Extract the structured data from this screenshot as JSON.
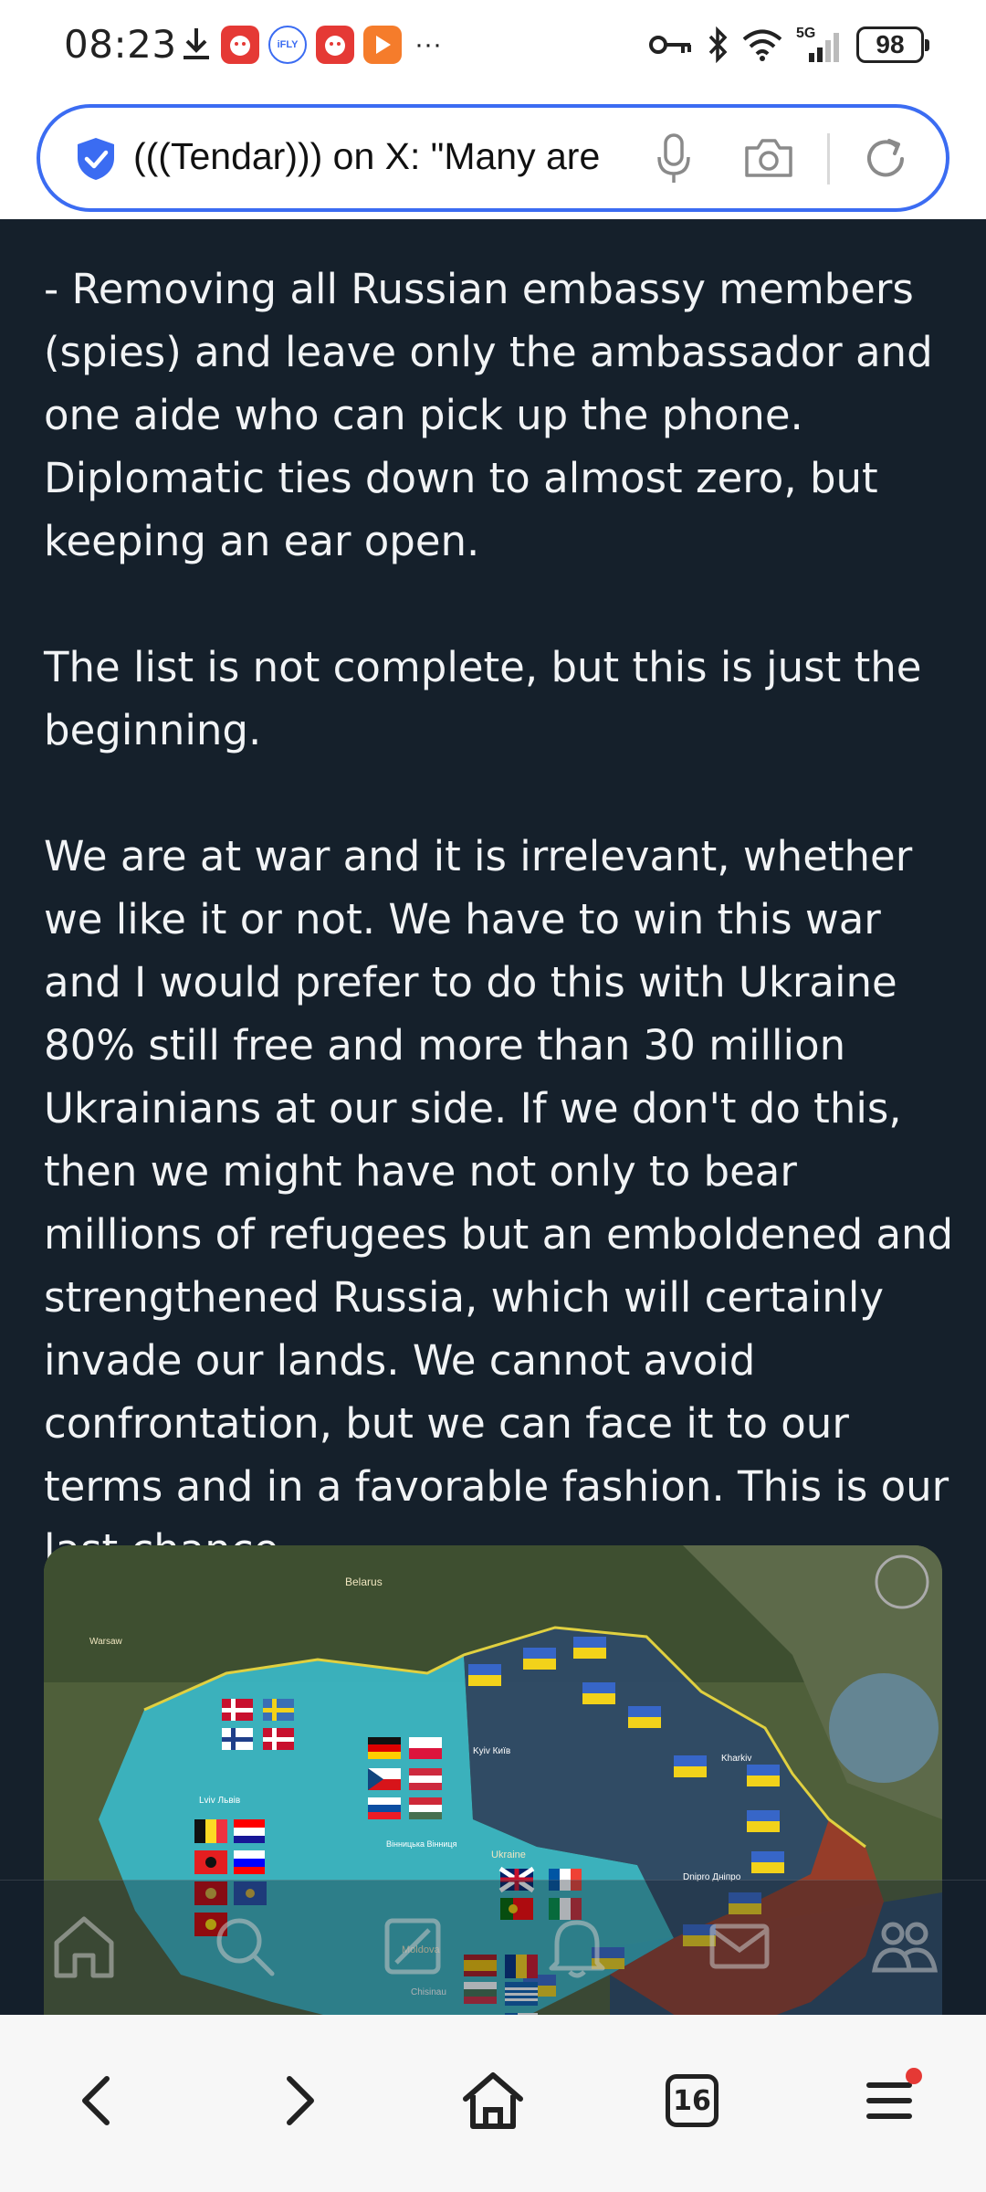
{
  "status_bar": {
    "time": "08:23",
    "left_icons": [
      "download-icon",
      "app-icon",
      "ifly-icon",
      "app-icon",
      "video-app-icon",
      "more-dots-icon"
    ],
    "ifly_label": "iFLY",
    "more": "···",
    "network": "5G",
    "battery": "98"
  },
  "address_bar": {
    "url_text": "(((Tendar))) on X: \"Many are",
    "icons": [
      "shield-check-icon",
      "microphone-icon",
      "camera-icon",
      "reload-icon"
    ],
    "accent_color": "#3b6cf2"
  },
  "post": {
    "paragraph_1": "- Removing all Russian embassy members (spies) and leave only the ambassador and one aide who can pick up the phone. Diplomatic ties down to almost zero, but keeping an ear open.",
    "paragraph_2": "The list is not complete, but this is just the beginning.",
    "paragraph_3": "We are at war and it is irrelevant, whether we like it or not. We have to win this war and I would prefer to do this with Ukraine 80% still free and more than 30 million Ukrainians at our side. If we don't do this, then we might have not only to bear millions of refugees but an emboldened and strengthened Russia, which will certainly invade our lands. We cannot avoid confrontation, but we can face it to our terms and in a favorable fashion. This is our last chance.",
    "background_color": "#15202b"
  },
  "map": {
    "labels": {
      "belarus": "Belarus",
      "warsaw": "Warsaw",
      "kyiv": "Kyiv Київ",
      "kharkiv": "Kharkiv",
      "lviv": "Lviv Львів",
      "vinnytsia": "Вінницька Вінниця",
      "ukraine": "Ukraine",
      "dnipro": "Dnipro Дніпро",
      "moldova": "Moldova",
      "chisinau": "Chisinau"
    }
  },
  "x_nav": {
    "items": [
      "home-icon",
      "search-icon",
      "grok-icon",
      "notifications-icon",
      "messages-icon",
      "communities-icon"
    ]
  },
  "bottom_bar": {
    "items": [
      "back-icon",
      "forward-icon",
      "home-icon",
      "tabs-icon",
      "menu-icon"
    ],
    "tab_count": "16"
  }
}
